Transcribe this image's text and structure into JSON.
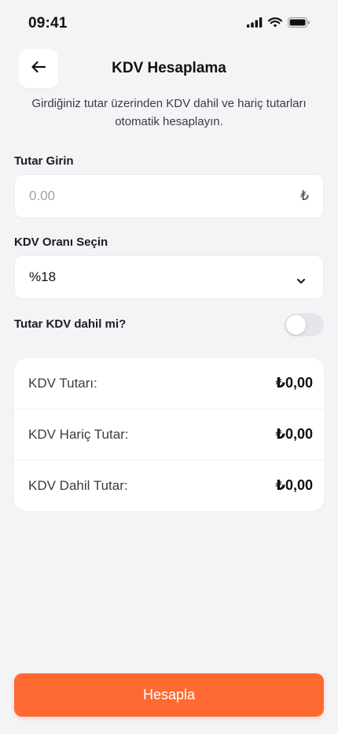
{
  "status_bar": {
    "time": "09:41"
  },
  "header": {
    "title": "KDV Hesaplama"
  },
  "subtitle": "Girdiğiniz tutar üzerinden KDV dahil ve hariç tutarları otomatik hesaplayın.",
  "amount_field": {
    "label": "Tutar Girin",
    "placeholder": "0.00",
    "value": "",
    "currency_symbol": "₺"
  },
  "rate_field": {
    "label": "KDV Oranı Seçin",
    "selected": "%18"
  },
  "vat_included": {
    "label": "Tutar KDV dahil mi?",
    "enabled": false
  },
  "results": [
    {
      "label": "KDV Tutarı:",
      "value": "₺0,00"
    },
    {
      "label": "KDV Hariç Tutar:",
      "value": "₺0,00"
    },
    {
      "label": "KDV Dahil Tutar:",
      "value": "₺0,00"
    }
  ],
  "action": {
    "label": "Hesapla"
  },
  "colors": {
    "accent": "#ff6a33",
    "background": "#f4f4f6",
    "card": "#ffffff"
  }
}
